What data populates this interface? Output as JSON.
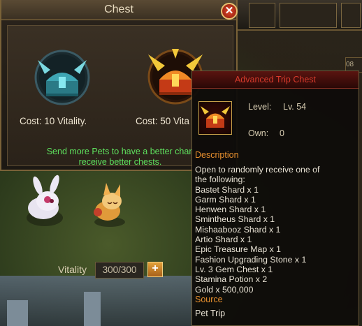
{
  "chest_window": {
    "title": "Chest",
    "close_symbol": "✕",
    "basic_chest_cost": "Cost: 10 Vitality.",
    "advanced_chest_cost": "Cost: 50 Vita",
    "message_line1": "Send more Pets to have a better chan",
    "message_line2": "receive better chests."
  },
  "vitality": {
    "label": "Vitality",
    "value": "300/300",
    "plus": "+"
  },
  "right_strip": {
    "text": "08"
  },
  "tooltip": {
    "title": "Advanced Trip Chest",
    "level_label": "Level:",
    "level_value": "Lv. 54",
    "own_label": "Own:",
    "own_value": "0",
    "description_title": "Description",
    "description_lines": [
      "Open to randomly receive one of",
      "the following:",
      "Bastet Shard x 1",
      "Garm Shard x 1",
      "Henwen Shard x 1",
      "Smintheus Shard x 1",
      "Mishaabooz Shard x 1",
      "Artio Shard x 1",
      "Epic Treasure Map x 1",
      "Fashion Upgrading Stone x 1",
      "Lv. 3 Gem Chest x 1",
      "Stamina Potion x 2",
      "Gold x 500,000"
    ],
    "source_title": "Source",
    "source_value": "Pet Trip"
  },
  "colors": {
    "message_green": "#5ee05e",
    "section_orange": "#e8902e",
    "tooltip_title_red": "#d83a2c",
    "frame_gold": "#7a6238"
  },
  "icons": [
    "close-icon",
    "basic-chest-icon",
    "advanced-chest-icon",
    "plus-icon",
    "pet-bunny",
    "pet-fox"
  ]
}
